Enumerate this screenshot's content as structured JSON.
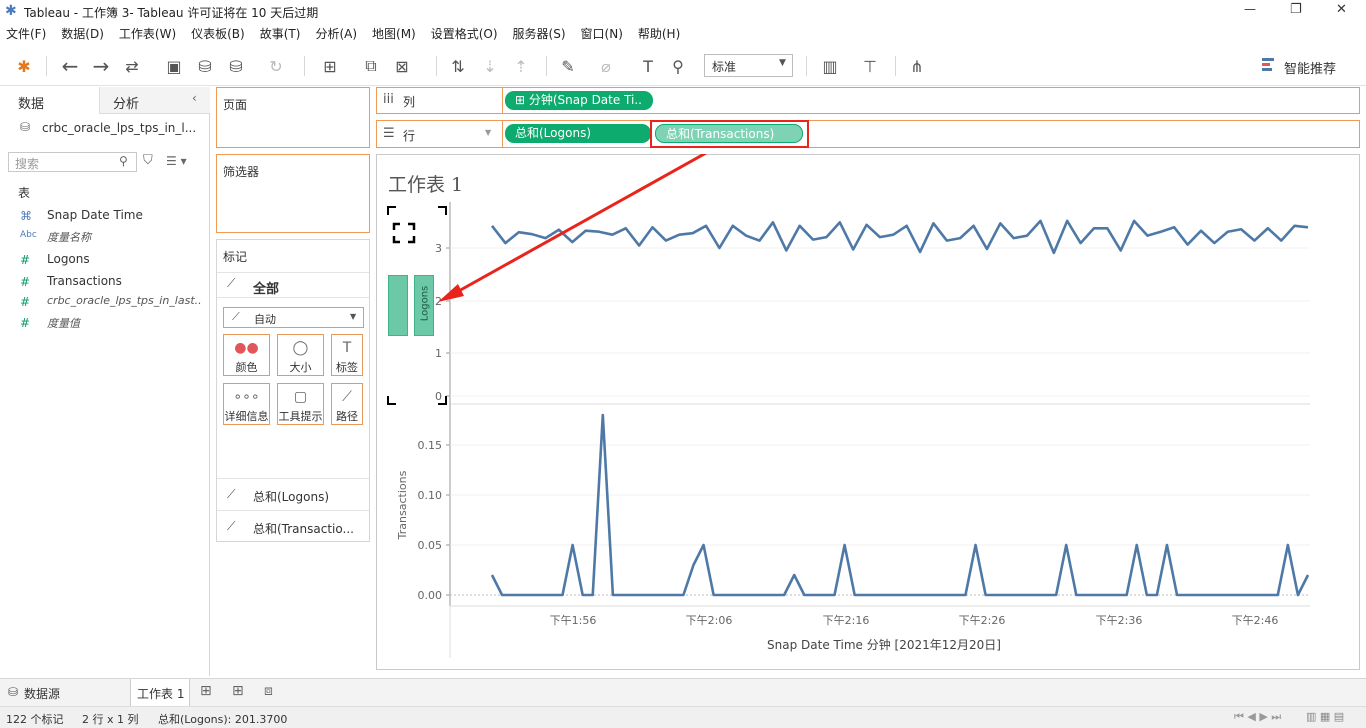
{
  "window": {
    "title": "Tableau - 工作簿 3- Tableau 许可证将在 10 天后过期",
    "minimize": "—",
    "restore": "❐",
    "close": "✕"
  },
  "menu": [
    "文件(F)",
    "数据(D)",
    "工作表(W)",
    "仪表板(B)",
    "故事(T)",
    "分析(A)",
    "地图(M)",
    "设置格式(O)",
    "服务器(S)",
    "窗口(N)",
    "帮助(H)"
  ],
  "toolbar": {
    "fit_select": "标准",
    "smart_recommend": "智能推荐"
  },
  "left": {
    "tab_data": "数据",
    "tab_analysis": "分析",
    "datasource": "crbc_oracle_lps_tps_in_l...",
    "search_placeholder": "搜索",
    "section_table": "表",
    "fields": [
      {
        "icon": "⌘",
        "name": "Snap Date Time",
        "italic": false
      },
      {
        "icon": "Abc",
        "name": "度量名称",
        "italic": true
      },
      {
        "icon": "#",
        "name": "Logons",
        "italic": false
      },
      {
        "icon": "#",
        "name": "Transactions",
        "italic": false
      },
      {
        "icon": "#",
        "name": "crbc_oracle_lps_tps_in_last...",
        "italic": true
      },
      {
        "icon": "#",
        "name": "度量值",
        "italic": true
      }
    ]
  },
  "cards": {
    "pages": "页面",
    "filters": "筛选器",
    "marks": "标记",
    "marks_all": "全部",
    "marks_type": "自动",
    "buttons": [
      "颜色",
      "大小",
      "标签",
      "详细信息",
      "工具提示",
      "路径"
    ],
    "mark_rows": [
      "总和(Logons)",
      "总和(Transactio..."
    ]
  },
  "shelves": {
    "columns_label": "列",
    "rows_label": "行",
    "columns_pill": "分钟(Snap Date Ti..",
    "rows_pills": [
      "总和(Logons)",
      "总和(Transactions)"
    ]
  },
  "sheet": {
    "title": "工作表 1",
    "drop_label": "Logons"
  },
  "chart_data": {
    "type": "line",
    "title": "工作表 1",
    "xlabel": "Snap Date Time 分钟 [2021年12月20日]",
    "x_ticks": [
      "下午1:56",
      "下午2:06",
      "下午2:16",
      "下午2:26",
      "下午2:36",
      "下午2:46"
    ],
    "panes": [
      {
        "ylabel": "Logons",
        "ylim": [
          0,
          3.8
        ],
        "y_ticks": [
          "0",
          "1",
          "2",
          "3"
        ],
        "values": [
          3.45,
          3.1,
          3.32,
          3.28,
          3.2,
          3.37,
          3.12,
          3.35,
          3.33,
          3.27,
          3.4,
          3.05,
          3.42,
          3.15,
          3.27,
          3.3,
          3.45,
          3.0,
          3.45,
          3.25,
          3.15,
          3.52,
          2.95,
          3.45,
          3.17,
          3.22,
          3.52,
          2.97,
          3.47,
          3.22,
          3.27,
          3.45,
          2.92,
          3.5,
          3.15,
          3.2,
          3.45,
          2.98,
          3.5,
          3.2,
          3.25,
          3.55,
          2.9,
          3.55,
          3.1,
          3.4,
          3.4,
          2.95,
          3.55,
          3.25,
          3.33,
          3.42,
          3.07,
          3.35,
          3.1,
          3.33,
          3.38,
          3.15,
          3.4,
          3.15,
          3.45,
          3.42
        ]
      },
      {
        "ylabel": "Transactions",
        "ylim": [
          -0.01,
          0.18
        ],
        "y_ticks": [
          "0.00",
          "0.05",
          "0.10",
          "0.15"
        ],
        "values": [
          0.02,
          0.0,
          0.0,
          0.0,
          0.0,
          0.0,
          0.0,
          0.0,
          0.05,
          0.0,
          0.0,
          0.18,
          0.0,
          0.0,
          0.0,
          0.0,
          0.0,
          0.0,
          0.0,
          0.0,
          0.03,
          0.05,
          0.0,
          0.0,
          0.0,
          0.0,
          0.0,
          0.0,
          0.0,
          0.0,
          0.02,
          0.0,
          0.0,
          0.0,
          0.0,
          0.05,
          0.0,
          0.0,
          0.0,
          0.0,
          0.0,
          0.0,
          0.0,
          0.0,
          0.0,
          0.0,
          0.0,
          0.0,
          0.05,
          0.0,
          0.0,
          0.0,
          0.0,
          0.0,
          0.0,
          0.0,
          0.0,
          0.05,
          0.0,
          0.0,
          0.0,
          0.0,
          0.0,
          0.0,
          0.05,
          0.0,
          0.0,
          0.05,
          0.0,
          0.0,
          0.0,
          0.0,
          0.0,
          0.0,
          0.0,
          0.0,
          0.0,
          0.0,
          0.0,
          0.05,
          0.0,
          0.02
        ]
      }
    ]
  },
  "tabs": {
    "datasource": "数据源",
    "sheet": "工作表 1"
  },
  "status": {
    "marks": "122 个标记",
    "dims": "2 行 x 1 列",
    "sum": "总和(Logons): 201.3700"
  },
  "colors": {
    "line": "#4e79a7",
    "pill_green": "#0eab6f",
    "pill_light": "#7dd3b4",
    "orange": "#ee9a56",
    "annotation": "#e8241b"
  }
}
